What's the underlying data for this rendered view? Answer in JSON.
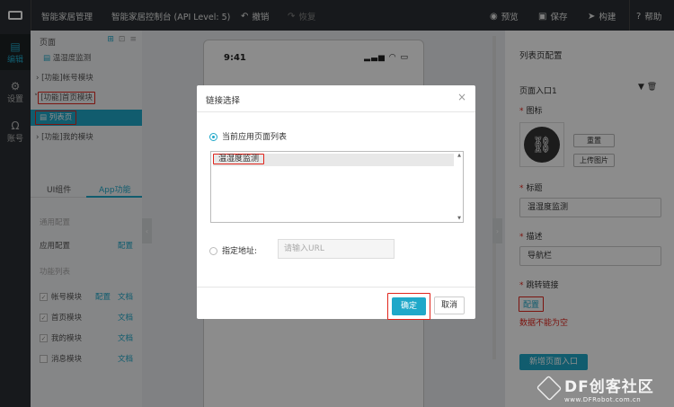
{
  "topbar": {
    "app_name": "智能家居管理",
    "console_title": "智能家居控制台 (API Level: 5)",
    "undo": "撤销",
    "redo": "恢复",
    "preview": "预览",
    "save": "保存",
    "build": "构建",
    "help": "帮助"
  },
  "leftnav": {
    "items": [
      {
        "label": "编辑",
        "icon": "edit-icon"
      },
      {
        "label": "设置",
        "icon": "gear-icon"
      },
      {
        "label": "账号",
        "icon": "user-icon"
      }
    ]
  },
  "pages": {
    "header": "页面",
    "tree": [
      {
        "label": "温湿度监测",
        "icon": "page-icon"
      },
      {
        "label": "[功能]帐号模块",
        "icon": "caret-right-icon"
      },
      {
        "label": "[功能]首页模块",
        "icon": "caret-down-icon"
      },
      {
        "label": "列表页",
        "icon": "page-icon"
      },
      {
        "label": "[功能]我的模块",
        "icon": "caret-right-icon"
      }
    ]
  },
  "tabs": [
    "UI组件",
    "App功能"
  ],
  "functions": {
    "general_label": "通用配置",
    "app_config": "应用配置",
    "config": "配置",
    "list_label": "功能列表",
    "rows": [
      {
        "name": "帐号模块",
        "checked": true,
        "config": "配置",
        "doc": "文档"
      },
      {
        "name": "首页模块",
        "checked": true,
        "doc": "文档"
      },
      {
        "name": "我的模块",
        "checked": true,
        "doc": "文档"
      },
      {
        "name": "消息模块",
        "checked": false,
        "doc": "文档"
      }
    ]
  },
  "phone": {
    "time": "9:41"
  },
  "right": {
    "title": "列表页配置",
    "entry": "页面入口1",
    "icon_label": "图标",
    "reset": "重置",
    "upload": "上传图片",
    "title_label": "标题",
    "title_value": "温湿度监测",
    "desc_label": "描述",
    "desc_value": "导航栏",
    "link_label": "跳转链接",
    "config_link": "配置",
    "error": "数据不能为空",
    "add_entry": "新增页面入口"
  },
  "modal": {
    "title": "链接选择",
    "option_current": "当前应用页面列表",
    "list_items": [
      "温湿度监测"
    ],
    "option_url": "指定地址:",
    "url_placeholder": "请输入URL",
    "ok": "确定",
    "cancel": "取消"
  },
  "watermark": {
    "big": "DF创客社区",
    "small": "www.DFRobot.com.cn"
  },
  "colors": {
    "accent": "#1fa8c9",
    "highlight": "#e0251c",
    "topbar": "#2b2f33"
  }
}
